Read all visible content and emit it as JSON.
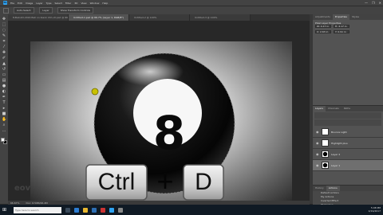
{
  "menu": {
    "logo": "Ps",
    "items": [
      "File",
      "Edit",
      "Image",
      "Layer",
      "Type",
      "Select",
      "Filter",
      "3D",
      "View",
      "Window",
      "Help"
    ]
  },
  "window_controls": [
    "—",
    "❐",
    "✕"
  ],
  "options": {
    "auto_select": "Auto-Select:",
    "layer": "Layer",
    "show_transform": "Show Transform Controls"
  },
  "tabs": [
    {
      "label": "8-Ball-2D-2016 Ball on blank Ctrl+D.psd @ 66.7% (Layer 1, RGB/8)",
      "active": false
    },
    {
      "label": "Untitled-1.psd @ 66.7% (Layer 1, RGB/8*)",
      "active": true
    },
    {
      "label": "Untitled-2 @ 100%",
      "active": false
    },
    {
      "label": "Untitled-3 @ 100%",
      "active": false
    }
  ],
  "canvas": {
    "ball_number": "8",
    "key1": "Ctrl",
    "plus": "+",
    "key2": "D",
    "watermark": "eov"
  },
  "status": {
    "zoom": "66.67%",
    "doc": "Doc: 6.59M/26.4M"
  },
  "panels": {
    "tabs": [
      "Adjustments",
      "Properties",
      "Styles"
    ],
    "properties_title": "Pixel Layer Properties",
    "w": "W: 4.17 in",
    "h": "H: 4.17 in",
    "x": "X: 2.63 in",
    "y": "Y: 0.91 in",
    "layers_tabs": [
      "Layers",
      "Channels",
      "Paths"
    ],
    "layers": [
      {
        "name": "Bounce Light",
        "thumb": "white",
        "selected": false
      },
      {
        "name": "Highlight plus",
        "thumb": "white",
        "selected": false
      },
      {
        "name": "Layer 2",
        "thumb": "ball",
        "selected": false
      },
      {
        "name": "Layer 1",
        "thumb": "ball",
        "selected": true
      }
    ],
    "actions_tabs": [
      "History",
      "Actions"
    ],
    "actions": [
      "Default Actions",
      "My Actions",
      "Inverted Effect",
      "Photoshop"
    ]
  },
  "taskbar": {
    "search": "Type here to search",
    "time": "5:08 PM",
    "date": "4/19/2017"
  },
  "colors": {
    "ps_blue": "#2fa3f2",
    "panel": "#535353",
    "taskbar": "#101a24"
  }
}
